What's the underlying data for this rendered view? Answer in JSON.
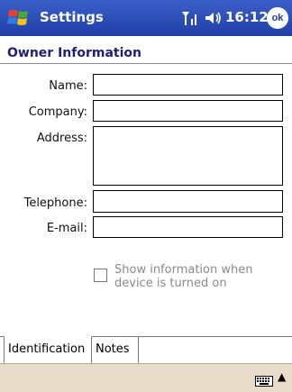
{
  "titlebar": {
    "app_title": "Settings",
    "clock": "16:12",
    "ok_label": "ok"
  },
  "page": {
    "title": "Owner Information"
  },
  "form": {
    "name_label": "Name:",
    "company_label": "Company:",
    "address_label": "Address:",
    "telephone_label": "Telephone:",
    "email_label": "E-mail:",
    "name_value": "",
    "company_value": "",
    "address_value": "",
    "telephone_value": "",
    "email_value": "",
    "checkbox_label": "Show information when device is turned on",
    "checkbox_checked": false
  },
  "tabs": [
    {
      "label": "Identification",
      "active": true
    },
    {
      "label": "Notes",
      "active": false
    }
  ],
  "icons": {
    "start": "windows-flag-icon",
    "signal": "signal-icon",
    "volume": "speaker-icon",
    "keyboard": "keyboard-icon",
    "input_menu": "up-arrow-icon"
  }
}
